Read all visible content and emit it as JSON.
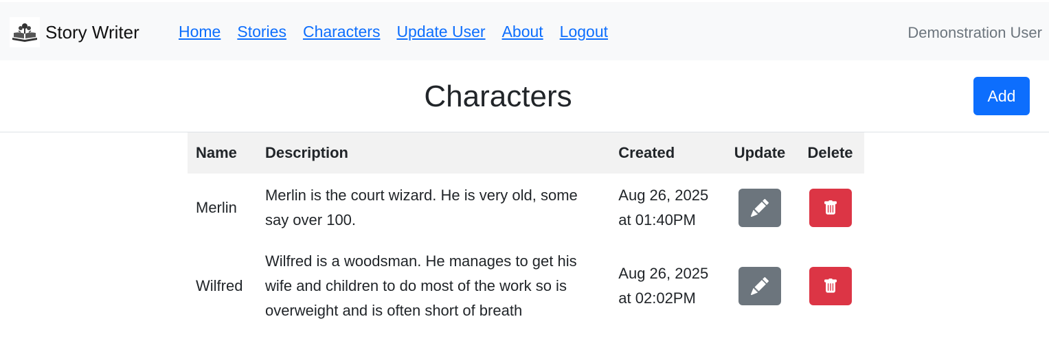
{
  "navbar": {
    "brand": "Story Writer",
    "links": [
      "Home",
      "Stories",
      "Characters",
      "Update User",
      "About",
      "Logout"
    ],
    "user": "Demonstration User"
  },
  "page": {
    "title": "Characters",
    "add_label": "Add"
  },
  "table": {
    "headers": [
      "Name",
      "Description",
      "Created",
      "Update",
      "Delete"
    ],
    "rows": [
      {
        "name": "Merlin",
        "description": "Merlin is the court wizard. He is very old, some say over 100.",
        "created": "Aug 26, 2025 at 01:40PM"
      },
      {
        "name": "Wilfred",
        "description": "Wilfred is a woodsman. He manages to get his wife and children to do most of the work so is overweight and is often short of breath",
        "created": "Aug 26, 2025 at 02:02PM"
      }
    ]
  },
  "colors": {
    "primary": "#0d6efd",
    "secondary": "#6c757d",
    "danger": "#dc3545",
    "navbar_bg": "#f8f9fa"
  },
  "icons": {
    "update": "pencil-icon",
    "delete": "trash-icon",
    "logo": "open-book-icon"
  }
}
